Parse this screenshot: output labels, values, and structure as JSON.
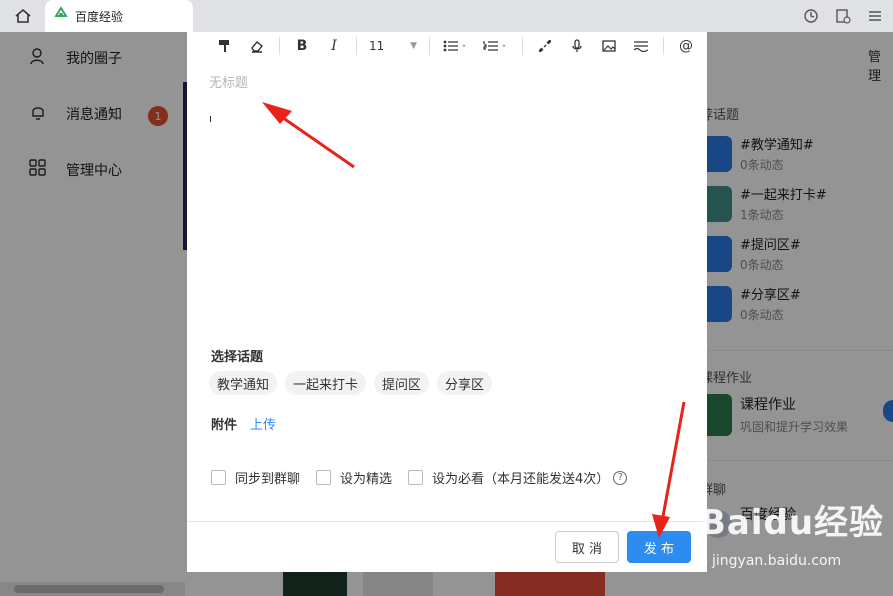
{
  "browser": {
    "tab_title": "百度经验"
  },
  "sidebar": {
    "items": [
      {
        "label": "我的圈子",
        "icon": "people-icon"
      },
      {
        "label": "消息通知",
        "icon": "bell-icon",
        "badge": "1"
      },
      {
        "label": "管理中心",
        "icon": "grid-icon"
      }
    ]
  },
  "right_panel": {
    "manage": "管理",
    "recommend_heading": "荐话题",
    "topics": [
      {
        "title": "#教学通知#",
        "count": "0条动态"
      },
      {
        "title": "#一起来打卡#",
        "count": "1条动态"
      },
      {
        "title": "#提问区#",
        "count": "0条动态"
      },
      {
        "title": "#分享区#",
        "count": "0条动态"
      }
    ],
    "course_heading": "课程作业",
    "course_title": "课程作业",
    "course_sub": "巩固和提升学习效果",
    "chat_heading": "群聊",
    "chat_title": "百度经验"
  },
  "modal": {
    "toolbar": {
      "font_size": "11"
    },
    "title_placeholder": "无标题",
    "topic_section_label": "选择话题",
    "topic_chips": [
      "教学通知",
      "一起来打卡",
      "提问区",
      "分享区"
    ],
    "attachment_label": "附件",
    "upload_label": "上传",
    "options": [
      {
        "label": "同步到群聊"
      },
      {
        "label": "设为精选"
      },
      {
        "label": "设为必看（本月还能发送4次）"
      }
    ],
    "help_symbol": "?",
    "cancel_label": "取 消",
    "publish_label": "发 布"
  },
  "watermark": {
    "brand": "Baidu经验",
    "url": "jingyan.baidu.com"
  },
  "colors": {
    "primary": "#2d8cf0",
    "badge": "#e2522b",
    "arrow": "#e8231a"
  }
}
